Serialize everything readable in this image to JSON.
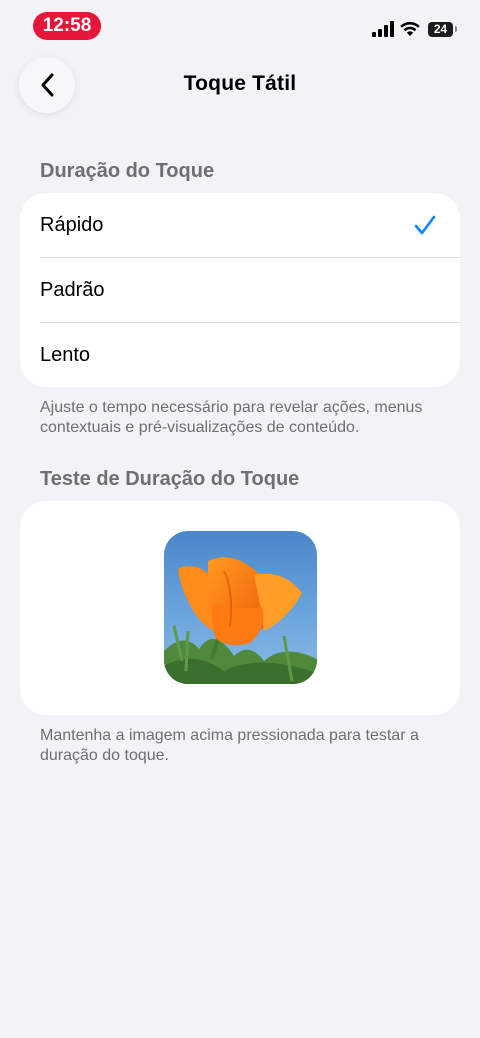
{
  "status_bar": {
    "time": "12:58",
    "battery": "24",
    "accent": "#e5163a"
  },
  "nav": {
    "back_icon": "chevron-left-icon",
    "title": "Toque Tátil"
  },
  "duration_section": {
    "header": "Duração do Toque",
    "options": [
      {
        "label": "Rápido",
        "selected": true
      },
      {
        "label": "Padrão",
        "selected": false
      },
      {
        "label": "Lento",
        "selected": false
      }
    ],
    "check_icon": "checkmark-icon",
    "check_color": "#0a84ff",
    "footnote": "Ajuste o tempo necessário para revelar ações, menus contextuais e pré-visualizações de conteúdo."
  },
  "test_section": {
    "header": "Teste de Duração do Toque",
    "image_icon": "poppy-flower-image",
    "footnote": "Mantenha a imagem acima pressionada para testar a duração do toque."
  }
}
